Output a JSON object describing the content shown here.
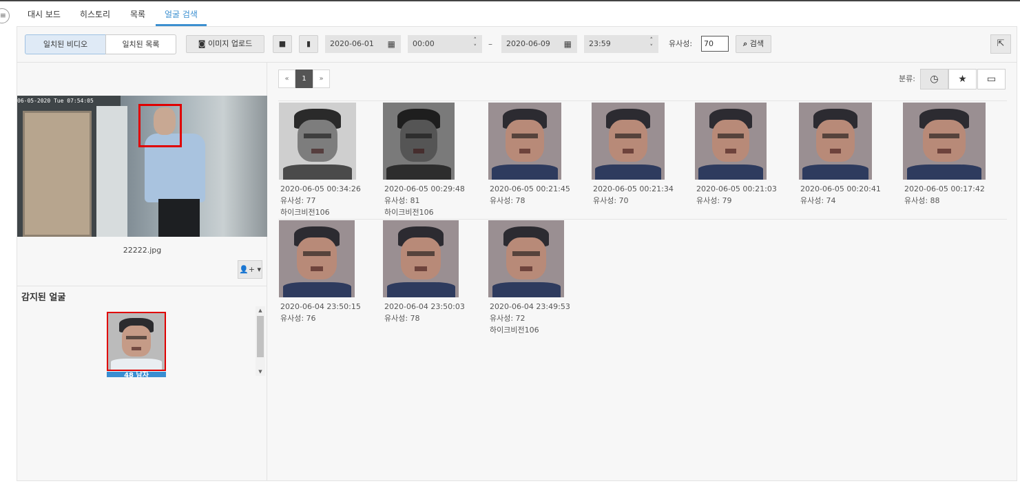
{
  "nav": {
    "tabs": [
      {
        "label": "대시 보드"
      },
      {
        "label": "히스토리"
      },
      {
        "label": "목록"
      },
      {
        "label": "얼굴 검색"
      }
    ],
    "active_tab": "얼굴 검색"
  },
  "toolbar": {
    "mode_video": "일치된 비디오",
    "mode_list": "일치된 목록",
    "upload_label": "이미지 업로드",
    "date_from": "2020-06-01",
    "time_from": "00:00",
    "date_to": "2020-06-09",
    "time_to": "23:59",
    "similarity_label": "유사성:",
    "similarity_value": "70",
    "search_label": "검색"
  },
  "left": {
    "preview_timestamp": "06-05-2020 Tue 07:54:05",
    "filename": "22222.jpg",
    "detected_title": "감지된 얼굴",
    "detected_label": "48 남자"
  },
  "right": {
    "pager": {
      "prev": "«",
      "current": "1",
      "next": "»"
    },
    "sort_label": "분류:",
    "results": [
      {
        "time": "2020-06-05 00:34:26",
        "similarity": "유사성: 77",
        "camera": "하이크비전106",
        "tone": "gray"
      },
      {
        "time": "2020-06-05 00:29:48",
        "similarity": "유사성: 81",
        "camera": "하이크비전106",
        "tone": "dark"
      },
      {
        "time": "2020-06-05 00:21:45",
        "similarity": "유사성: 78",
        "camera": "",
        "tone": "color"
      },
      {
        "time": "2020-06-05 00:21:34",
        "similarity": "유사성: 70",
        "camera": "",
        "tone": "color"
      },
      {
        "time": "2020-06-05 00:21:03",
        "similarity": "유사성: 79",
        "camera": "",
        "tone": "color"
      },
      {
        "time": "2020-06-05 00:20:41",
        "similarity": "유사성: 74",
        "camera": "",
        "tone": "color"
      },
      {
        "time": "2020-06-05 00:17:42",
        "similarity": "유사성: 88",
        "camera": "",
        "tone": "color"
      },
      {
        "time": "2020-06-04 23:50:15",
        "similarity": "유사성: 76",
        "camera": "",
        "tone": "color"
      },
      {
        "time": "2020-06-04 23:50:03",
        "similarity": "유사성: 78",
        "camera": "",
        "tone": "color"
      },
      {
        "time": "2020-06-04 23:49:53",
        "similarity": "유사성: 72",
        "camera": "하이크비전106",
        "tone": "color"
      }
    ]
  },
  "colors": {
    "accent": "#3b8fd0",
    "face_box": "#e00000",
    "panel_bg": "#f7f7f7"
  }
}
